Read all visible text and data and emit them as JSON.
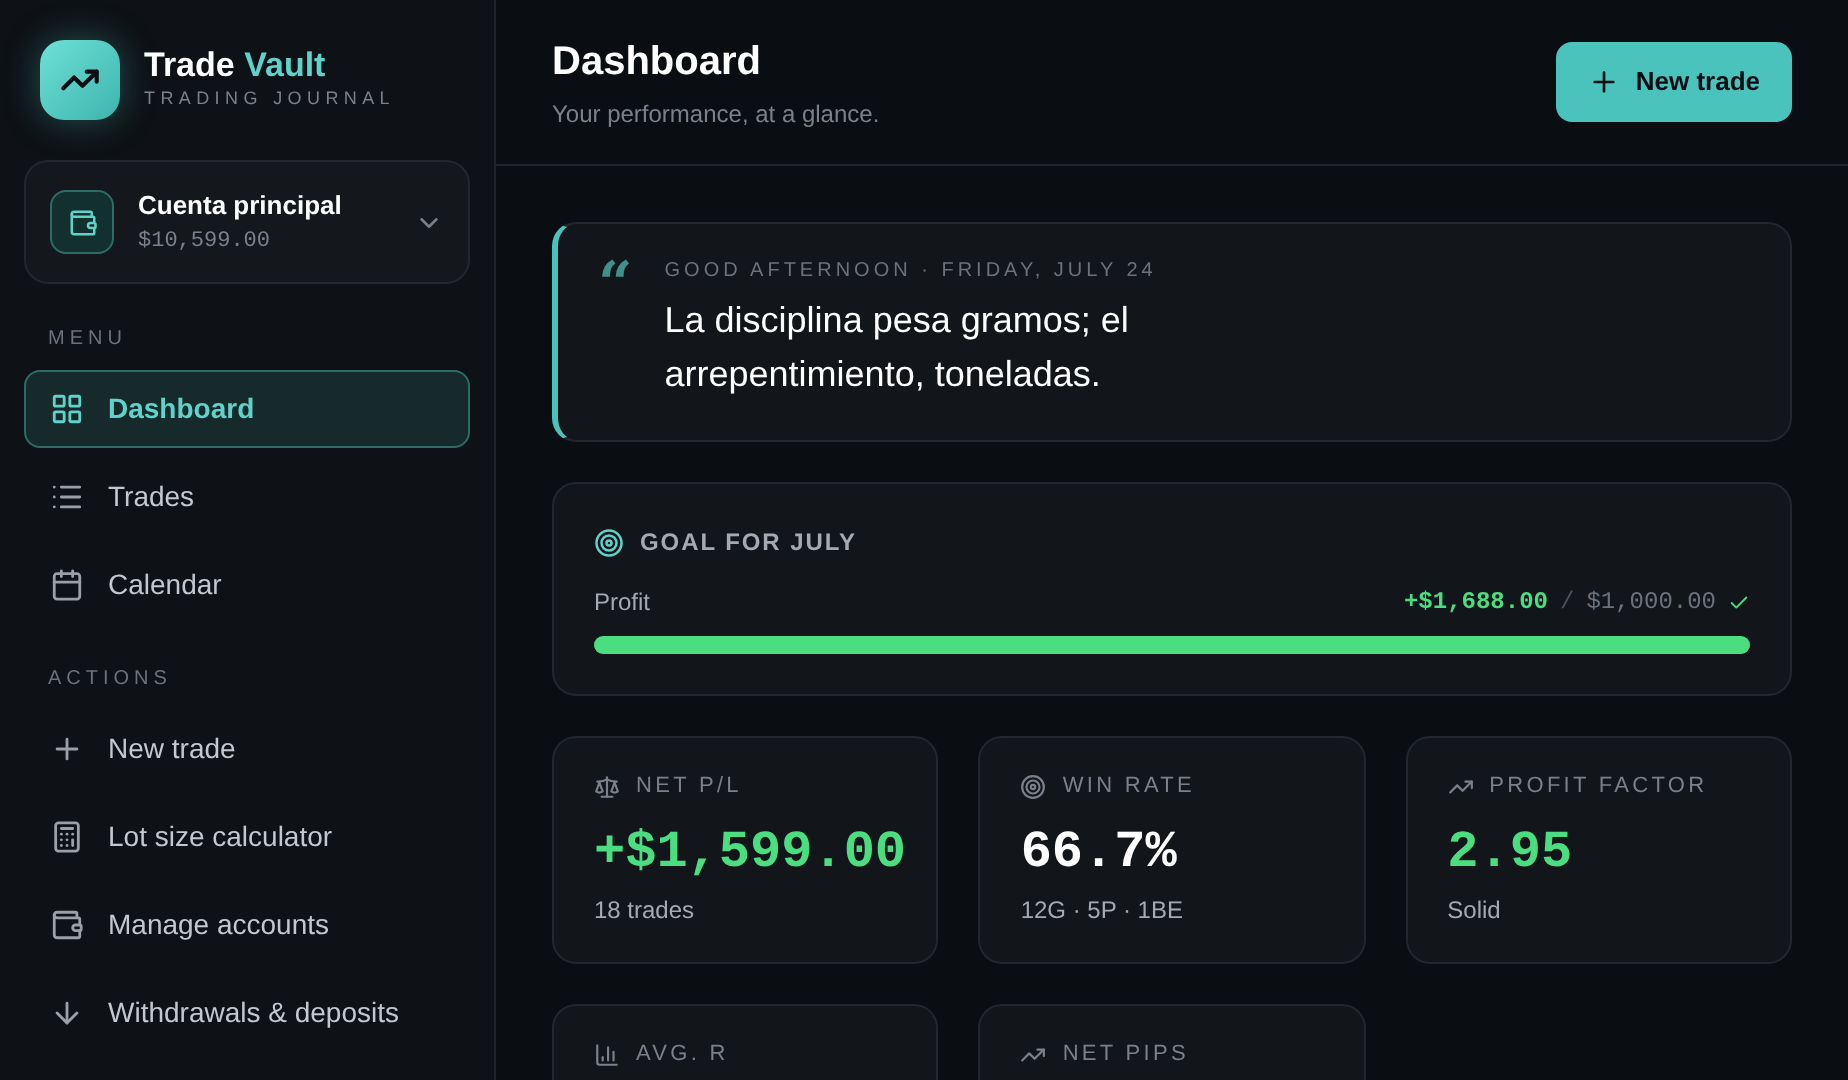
{
  "brand": {
    "name": "Trade",
    "accent": "Vault",
    "tagline": "TRADING JOURNAL"
  },
  "account": {
    "name": "Cuenta principal",
    "balance": "$10,599.00"
  },
  "sidebar": {
    "sections": [
      {
        "title": "MENU",
        "items": [
          {
            "label": "Dashboard",
            "selected": true
          },
          {
            "label": "Trades",
            "selected": false
          },
          {
            "label": "Calendar",
            "selected": false
          }
        ]
      },
      {
        "title": "ACTIONS",
        "items": [
          {
            "label": "New trade",
            "selected": false
          },
          {
            "label": "Lot size calculator",
            "selected": false
          },
          {
            "label": "Manage accounts",
            "selected": false
          },
          {
            "label": "Withdrawals & deposits",
            "selected": false
          }
        ]
      }
    ]
  },
  "header": {
    "title": "Dashboard",
    "subtitle": "Your performance, at a glance.",
    "button": "New trade"
  },
  "quote": {
    "mark": "“",
    "greeting": "GOOD AFTERNOON · FRIDAY, JULY 24",
    "text": "La disciplina pesa gramos; el arrepentimiento, toneladas."
  },
  "goal": {
    "title": "GOAL FOR JULY",
    "label": "Profit",
    "current": "+$1,688.00",
    "separator": "/",
    "target": "$1,000.00",
    "achieved": true,
    "level": 1
  },
  "stats": [
    {
      "label": "NET P/L",
      "value": "+$1,599.00",
      "color": "#4ade80",
      "note": "18 trades"
    },
    {
      "label": "WIN RATE",
      "value": "66.7%",
      "color": "#ffffff",
      "note": "12G · 5P · 1BE"
    },
    {
      "label": "PROFIT FACTOR",
      "value": "2.95",
      "color": "#4ade80",
      "note": "Solid"
    },
    {
      "label": "AVG. R"
    },
    {
      "label": "NET PIPS"
    }
  ]
}
